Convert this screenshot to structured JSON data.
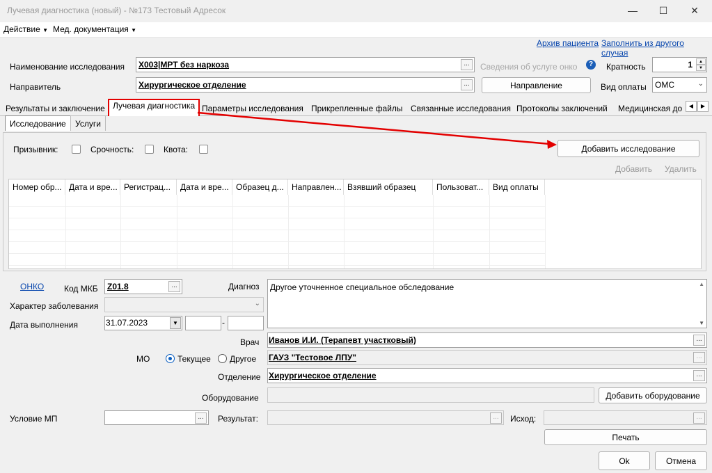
{
  "window": {
    "title": "Лучевая диагностика (новый) - №173 Тестовый Адресок",
    "minimize_glyph": "—",
    "maximize_glyph": "☐",
    "close_glyph": "✕"
  },
  "menu": {
    "items": [
      {
        "label": "Действие"
      },
      {
        "label": "Мед. документация"
      }
    ]
  },
  "top_links": {
    "archive": "Архив пациента",
    "fill_from": "Заполнить из другого случая"
  },
  "study": {
    "name_label": "Наименование исследования",
    "name_value": "Х003|МРТ без наркоза",
    "service_info": "Сведения об услуге онко",
    "multiplicity_label": "Кратность",
    "multiplicity_value": "1",
    "referrer_label": "Направитель",
    "referrer_value": "Хирургическое отделение",
    "direction_button": "Направление",
    "payment_label": "Вид оплаты",
    "payment_value": "ОМС"
  },
  "tabs": [
    {
      "label": "Результаты и заключение"
    },
    {
      "label": "Лучевая диагностика"
    },
    {
      "label": "Параметры исследования"
    },
    {
      "label": "Прикрепленные файлы"
    },
    {
      "label": "Связанные исследования"
    },
    {
      "label": "Протоколы заключений"
    },
    {
      "label": "Медицинская до"
    }
  ],
  "subtabs": [
    {
      "label": "Исследование"
    },
    {
      "label": "Услуги"
    }
  ],
  "flags": {
    "conscript": "Призывник:",
    "urgency": "Срочность:",
    "quota": "Квота:"
  },
  "add_study_button": "Добавить исследование",
  "grid_actions": {
    "add": "Добавить",
    "delete": "Удалить"
  },
  "grid": {
    "columns": [
      {
        "label": "Номер обр..."
      },
      {
        "label": "Дата и вре..."
      },
      {
        "label": "Регистрац..."
      },
      {
        "label": "Дата и вре..."
      },
      {
        "label": "Образец д..."
      },
      {
        "label": "Направлен..."
      },
      {
        "label": "Взявший образец"
      },
      {
        "label": "Пользоват..."
      },
      {
        "label": "Вид оплаты"
      }
    ]
  },
  "diagnosis": {
    "onko_link": "ОНКО",
    "mkb_label": "Код МКБ",
    "mkb_value": "Z01.8",
    "diag_label": "Диагноз",
    "diag_value": "Другое уточненное специальное обследование",
    "character_label": "Характер заболевания",
    "character_value": "",
    "date_label": "Дата выполнения",
    "date_value": "31.07.2023",
    "dash": "-"
  },
  "doctor": {
    "label": "Врач",
    "value": "Иванов И.И. (Терапевт участковый)"
  },
  "mo": {
    "label": "МО",
    "current": "Текущее",
    "other": "Другое",
    "value": "ГАУЗ \"Тестовое ЛПУ\""
  },
  "department": {
    "label": "Отделение",
    "value": "Хирургическое отделение"
  },
  "equipment": {
    "label": "Оборудование",
    "add_button": "Добавить оборудование"
  },
  "condition": {
    "label": "Условие МП",
    "result_label": "Результат:",
    "outcome_label": "Исход:"
  },
  "buttons": {
    "print": "Печать",
    "ok": "Ok",
    "cancel": "Отмена"
  },
  "colors": {
    "accent_red": "#e30000",
    "link_blue": "#0645ad",
    "radio_blue": "#0a5ec0"
  }
}
